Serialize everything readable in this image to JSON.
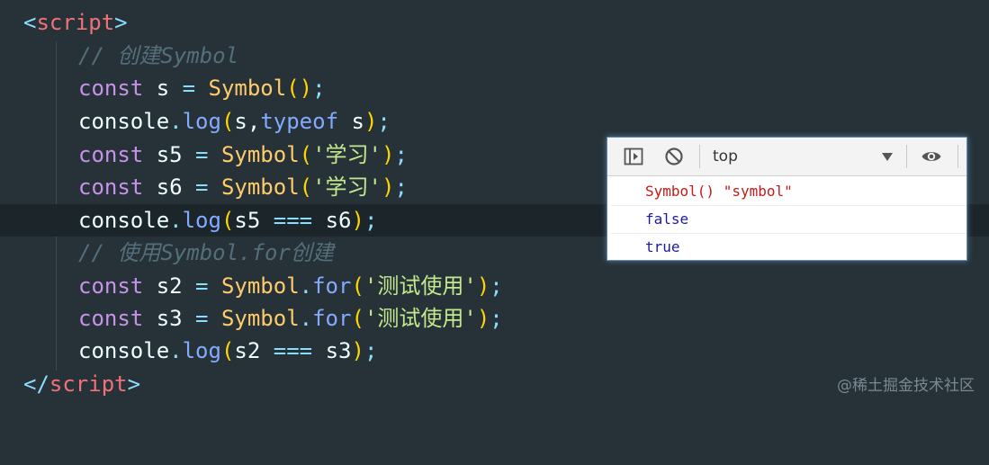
{
  "editor": {
    "lines": {
      "l1": {
        "lt": "<",
        "tag": "script",
        "gt": ">"
      },
      "l2": {
        "comment": "// 创建Symbol"
      },
      "l3": {
        "kw": "const",
        "var": " s ",
        "op": "=",
        "fn": " Symbol",
        "paren_open": "()",
        "semi": ";"
      },
      "l4": {
        "obj": "console",
        "dot": ".",
        "method": "log",
        "paren_open": "(",
        "args": "s,",
        "typeof": "typeof",
        "arg2": " s",
        "paren_close": ")",
        "semi": ";"
      },
      "l5": {
        "kw": "const",
        "var": " s5 ",
        "op": "=",
        "fn": " Symbol",
        "paren_open": "(",
        "str": "'学习'",
        "paren_close": ")",
        "semi": ";"
      },
      "l6": {
        "kw": "const",
        "var": " s6 ",
        "op": "=",
        "fn": " Symbol",
        "paren_open": "(",
        "str": "'学习'",
        "paren_close": ")",
        "semi": ";"
      },
      "l7": {
        "obj": "console",
        "dot": ".",
        "method": "log",
        "paren_open": "(",
        "a": "s5 ",
        "op": "===",
        "b": " s6",
        "paren_close": ")",
        "semi": ";"
      },
      "l8": {
        "comment": "// 使用Symbol.for创建"
      },
      "l9": {
        "kw": "const",
        "var": " s2 ",
        "op": "=",
        "fn": " Symbol",
        "dot": ".",
        "method": "for",
        "paren_open": "(",
        "str": "'测试使用'",
        "paren_close": ")",
        "semi": ";"
      },
      "l10": {
        "kw": "const",
        "var": " s3 ",
        "op": "=",
        "fn": " Symbol",
        "dot": ".",
        "method": "for",
        "paren_open": "(",
        "str": "'测试使用'",
        "paren_close": ")",
        "semi": ";"
      },
      "l11": {
        "obj": "console",
        "dot": ".",
        "method": "log",
        "paren_open": "(",
        "a": "s2 ",
        "op": "===",
        "b": " s3",
        "paren_close": ")",
        "semi": ";"
      },
      "l12": {
        "lt": "</",
        "tag": "script",
        "gt": ">"
      }
    }
  },
  "console_panel": {
    "toolbar": {
      "sidebar_icon": "sidebar-toggle-icon",
      "clear_icon": "block-icon",
      "context_value": "top",
      "eye_icon": "eye-icon"
    },
    "output": [
      {
        "part1": "Symbol() ",
        "part2": "\"symbol\""
      },
      {
        "text": "false"
      },
      {
        "text": "true"
      }
    ],
    "colors": {
      "string_red": "#c41a16",
      "boolean_blue": "#1a1aa6"
    }
  },
  "watermark": "@稀土掘金技术社区"
}
